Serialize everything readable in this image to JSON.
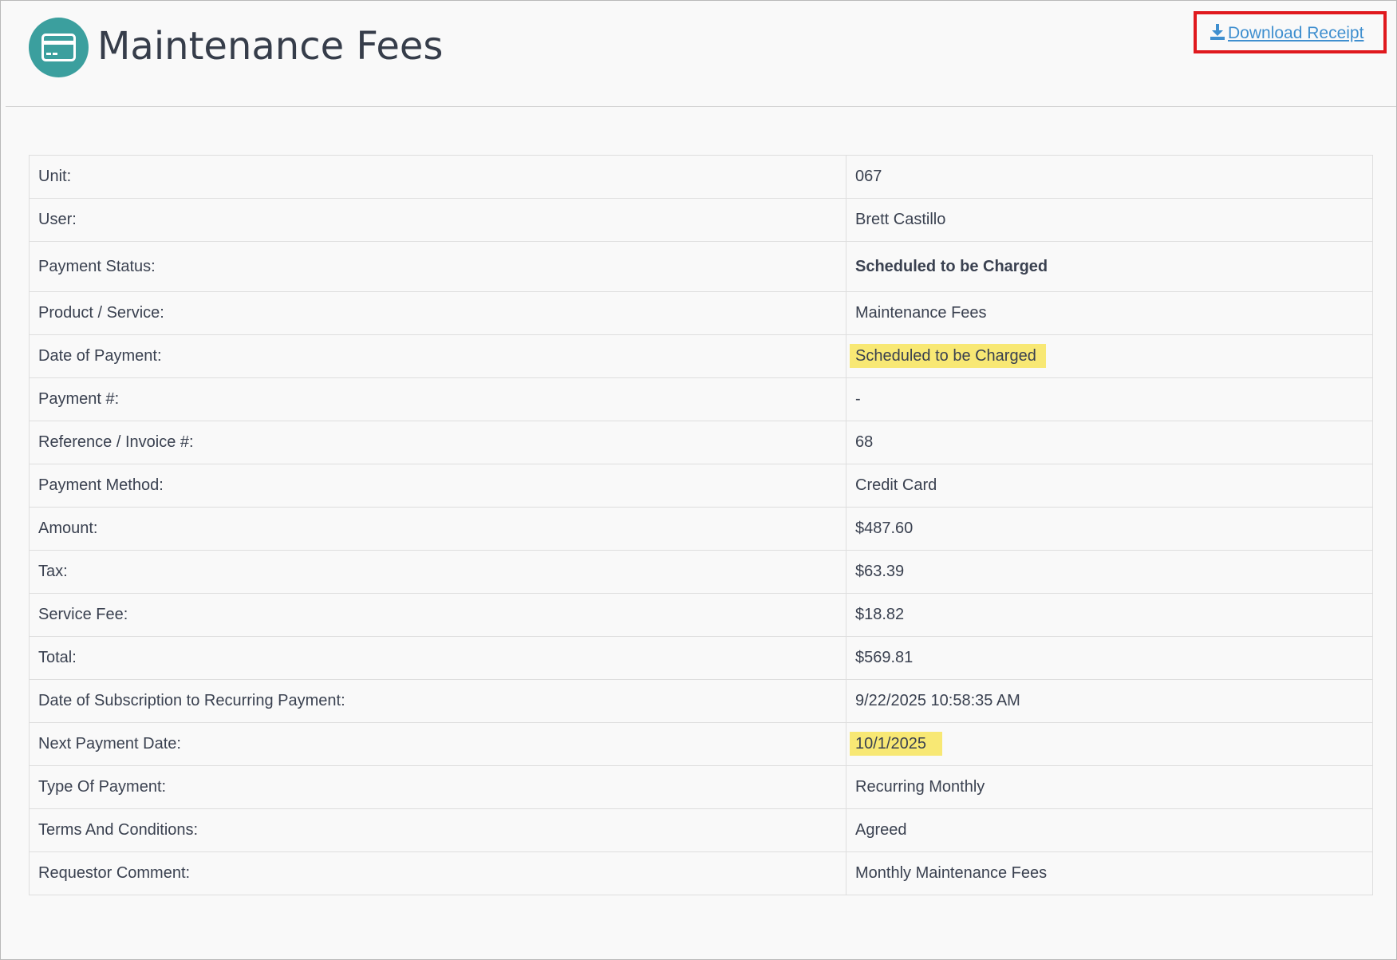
{
  "header": {
    "title": "Maintenance Fees",
    "logo_icon": "credit-card-icon",
    "download_label": "Download Receipt",
    "download_icon": "download-icon"
  },
  "colors": {
    "accent": "#3b9f9e",
    "link": "#3f8fcf",
    "highlight": "#f8e874",
    "annotation_box": "#e0191e"
  },
  "details": [
    {
      "label": "Unit:",
      "value": "067"
    },
    {
      "label": "User:",
      "value": "Brett Castillo"
    },
    {
      "label": "Payment Status:",
      "value": "Scheduled to be Charged"
    },
    {
      "label": "Product / Service:",
      "value": "Maintenance Fees"
    },
    {
      "label": "Date of Payment:",
      "value": "Scheduled to be Charged"
    },
    {
      "label": "Payment #:",
      "value": "-"
    },
    {
      "label": "Reference / Invoice #:",
      "value": "68"
    },
    {
      "label": "Payment Method:",
      "value": "Credit Card"
    },
    {
      "label": "Amount:",
      "value": "$487.60"
    },
    {
      "label": "Tax:",
      "value": "$63.39"
    },
    {
      "label": "Service Fee:",
      "value": "$18.82"
    },
    {
      "label": "Total:",
      "value": "$569.81"
    },
    {
      "label": "Date of Subscription to Recurring Payment:",
      "value": "9/22/2025 10:58:35 AM"
    },
    {
      "label": "Next Payment Date:",
      "value": "10/1/2025"
    },
    {
      "label": "Type Of Payment:",
      "value": "Recurring Monthly"
    },
    {
      "label": "Terms And Conditions:",
      "value": "Agreed"
    },
    {
      "label": "Requestor Comment:",
      "value": "Monthly Maintenance Fees"
    }
  ]
}
